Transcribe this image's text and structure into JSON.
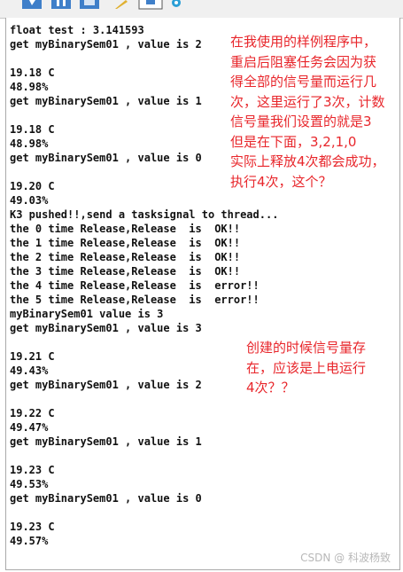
{
  "toolbar": {
    "icons": [
      "run-icon",
      "pause-icon",
      "stop-icon",
      "pencil-icon",
      "save-icon",
      "gear-icon"
    ]
  },
  "console": {
    "lines": [
      "float test : 3.141593",
      "get myBinarySem01 , value is 2",
      "",
      "19.18 C",
      "48.98%",
      "get myBinarySem01 , value is 1",
      "",
      "19.18 C",
      "48.98%",
      "get myBinarySem01 , value is 0",
      "",
      "19.20 C",
      "49.03%",
      "K3 pushed!!,send a tasksignal to thread...",
      "the 0 time Release,Release  is  OK!!",
      "the 1 time Release,Release  is  OK!!",
      "the 2 time Release,Release  is  OK!!",
      "the 3 time Release,Release  is  OK!!",
      "the 4 time Release,Release  is  error!!",
      "the 5 time Release,Release  is  error!!",
      "myBinarySem01 value is 3",
      "get myBinarySem01 , value is 3",
      "",
      "19.21 C",
      "49.43%",
      "get myBinarySem01 , value is 2",
      "",
      "19.22 C",
      "49.47%",
      "get myBinarySem01 , value is 1",
      "",
      "19.23 C",
      "49.53%",
      "get myBinarySem01 , value is 0",
      "",
      "19.23 C",
      "49.57%"
    ]
  },
  "annotations": {
    "note1": "在我使用的样例程序中，\n重启后阻塞任务会因为获\n得全部的信号量而运行几\n次，这里运行了3次，计数\n信号量我们设置的就是3\n但是在下面，3,2,1,0\n实际上释放4次都会成功，\n执行4次，这个？",
    "note2": "创建的时候信号量存\n在，应该是上电运行\n4次？？"
  },
  "watermark": "CSDN @ 科波杨致",
  "colors": {
    "annotation": "#e8262b",
    "text": "#111111",
    "background": "#ffffff",
    "toolbar": "#f0f0f0"
  }
}
